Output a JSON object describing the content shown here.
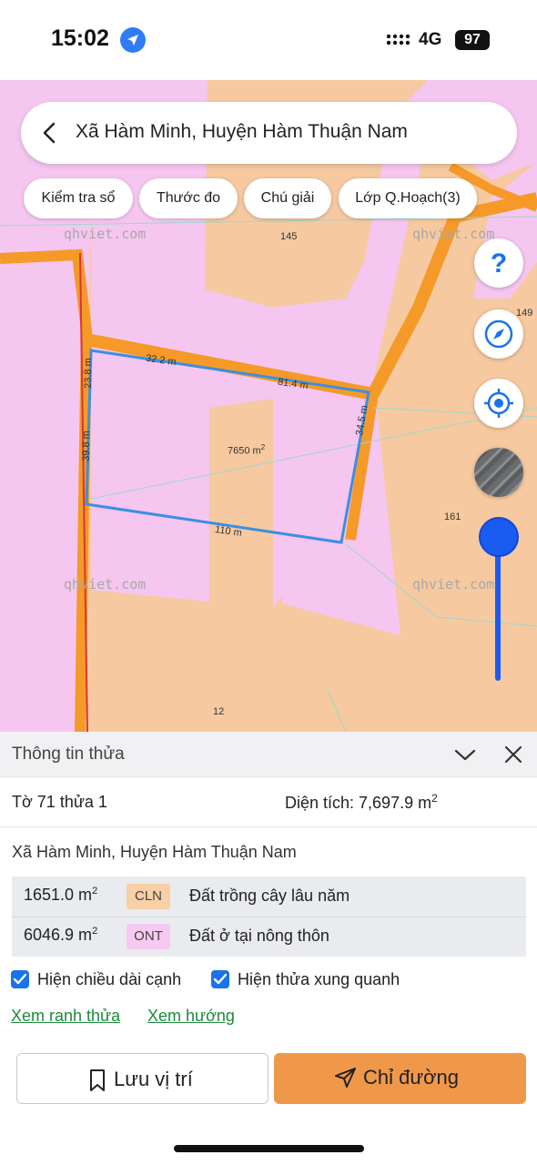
{
  "status_bar": {
    "time": "15:02",
    "network": "4G",
    "signal_icon": "signal-dots-icon",
    "battery": "97"
  },
  "search": {
    "title": "Xã Hàm Minh, Huyện Hàm Thuận Nam"
  },
  "chips": [
    {
      "label": "Kiểm tra sổ"
    },
    {
      "label": "Thước đo"
    },
    {
      "label": "Chú giải"
    },
    {
      "label": "Lớp Q.Hoạch(3)"
    }
  ],
  "map": {
    "watermark": "qhviet.com",
    "labels": {
      "parcel_145": "145",
      "parcel_149": "149",
      "parcel_161": "161",
      "parcel_12": "12",
      "edge_top_left": "32.2 m",
      "edge_top_right": "81.4 m",
      "edge_left_upper": "23.8 m",
      "edge_left_lower": "39.8 m",
      "edge_right": "34.5 m",
      "edge_bottom": "110 m",
      "area_value": "7650 m",
      "area_sup": "2"
    },
    "colors": {
      "residential": "#f5c6f0",
      "perennial": "#f6c9a0",
      "road": "#f59a28",
      "parcel_border": "#3b8fe3"
    },
    "buttons": {
      "help_icon": "question-icon",
      "compass_icon": "compass-icon",
      "locate_icon": "target-icon",
      "layer_icon": "satellite-icon"
    },
    "zoom_level_fraction": 1.0
  },
  "panel": {
    "title": "Thông tin thửa",
    "sheet_parcel": "Tờ 71 thửa 1",
    "area_label": "Diện tích: 7,697.9 m",
    "area_sup": "2",
    "address": "Xã Hàm Minh, Huyện Hàm Thuận Nam",
    "land_uses": [
      {
        "area": "1651.0 m",
        "sup": "2",
        "code": "CLN",
        "description": "Đất trồng cây lâu năm",
        "color": "#f9cfa6"
      },
      {
        "area": "6046.9 m",
        "sup": "2",
        "code": "ONT",
        "description": "Đất ở tại nông thôn",
        "color": "#f6c9f0"
      }
    ],
    "checkboxes": [
      {
        "label": "Hiện chiều dài cạnh",
        "checked": true
      },
      {
        "label": "Hiện thửa xung quanh",
        "checked": true
      }
    ],
    "links": [
      "Xem ranh thửa",
      "Xem hướng"
    ],
    "save_label": "Lưu vị trí",
    "directions_label": "Chỉ đường"
  }
}
